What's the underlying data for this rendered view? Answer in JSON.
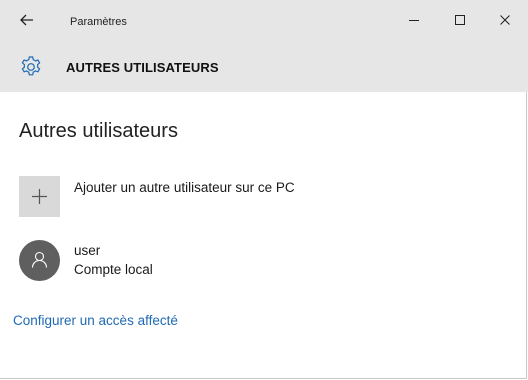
{
  "window": {
    "title": "Paramètres",
    "minimize_icon": "minimize-icon",
    "maximize_icon": "maximize-icon",
    "close_icon": "close-icon"
  },
  "header": {
    "icon": "gear-icon",
    "title": "AUTRES UTILISATEURS"
  },
  "main": {
    "page_title": "Autres utilisateurs",
    "add_user_label": "Ajouter un autre utilisateur sur ce PC",
    "users": [
      {
        "name": "user",
        "account_type": "Compte local"
      }
    ],
    "assigned_access_link": "Configurer un accès affecté"
  },
  "colors": {
    "chrome_bg": "#e6e6e6",
    "link": "#1f69b5",
    "avatar_bg": "#5f5f5f",
    "add_tile_bg": "#d9d9d9"
  }
}
